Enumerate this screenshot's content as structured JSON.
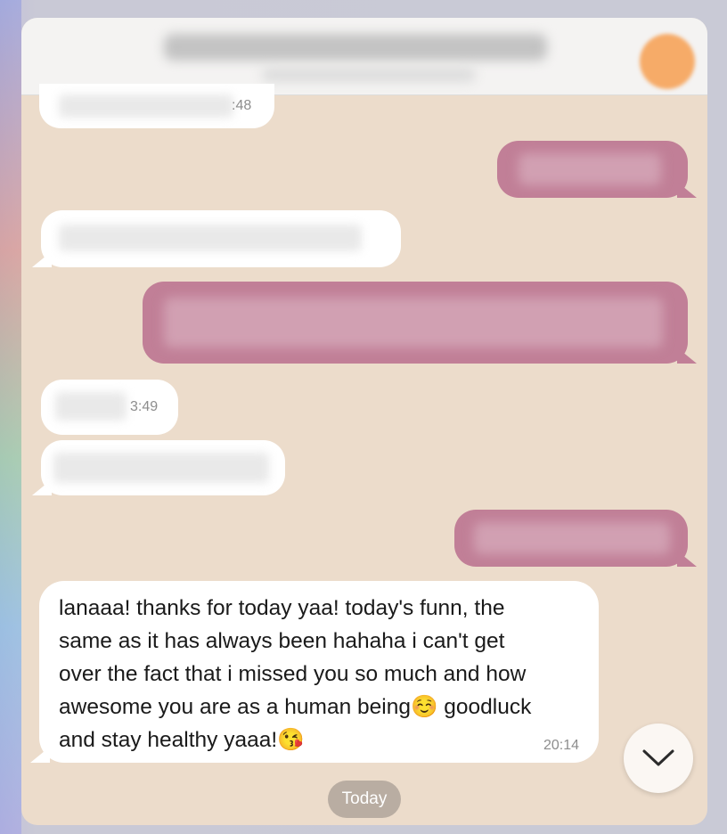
{
  "chat": {
    "incoming_time_1": ":48",
    "incoming_time_2": "3:49",
    "main_message": {
      "line_1": "lanaaa! thanks for today yaa! today's funn, the",
      "line_2": "same as it has always been hahaha i can't get",
      "line_3": "over the fact that i missed you so much and how",
      "line_4_a": "awesome you are as a human being",
      "emoji_1": "☺️",
      "line_4_b": " goodluck",
      "line_5_a": "and stay healthy yaaa!",
      "emoji_2": "😘",
      "time": "20:14"
    },
    "date_divider": "Today"
  },
  "icons": {
    "scroll_down": "chevron-down-icon"
  },
  "colors": {
    "chat_background": "#ecdccb",
    "incoming_bubble": "#ffffff",
    "outgoing_bubble": "#c17f97",
    "date_pill": "#b9ada2"
  }
}
